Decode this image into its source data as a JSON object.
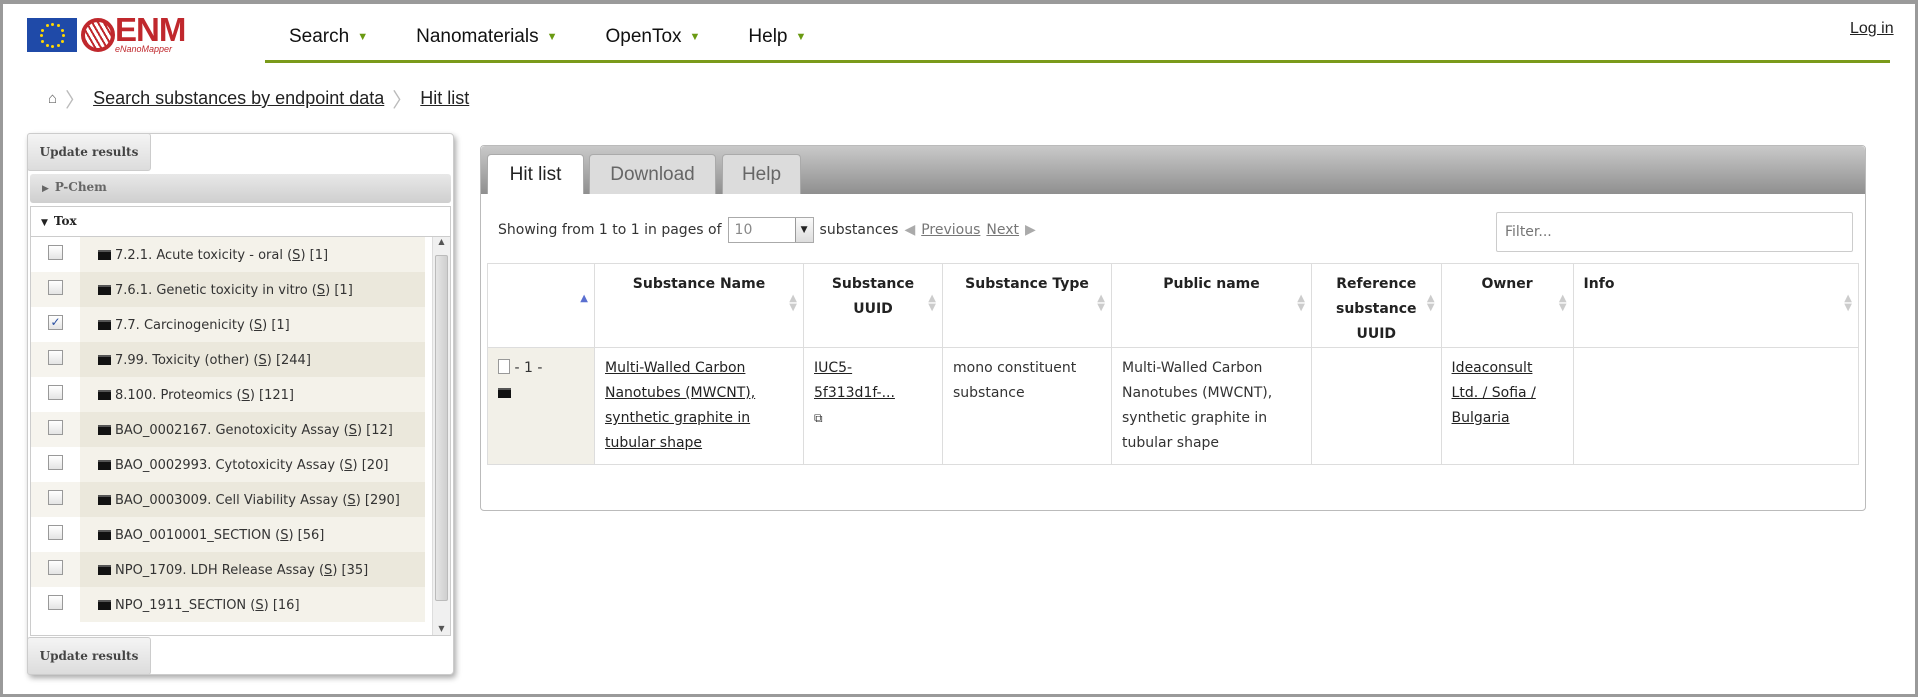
{
  "brand": {
    "name": "ENM",
    "subtitle": "eNanoMapper",
    "colors": {
      "accent": "#7a9a1a",
      "logo_red": "#c0282d",
      "eu_blue": "#1f4aa8"
    }
  },
  "nav": {
    "items": [
      {
        "label": "Search"
      },
      {
        "label": "Nanomaterials"
      },
      {
        "label": "OpenTox"
      },
      {
        "label": "Help"
      }
    ],
    "login": "Log in"
  },
  "breadcrumb": {
    "home_icon": "home-icon",
    "items": [
      "Search substances by endpoint data",
      "Hit list"
    ]
  },
  "sidebar": {
    "update_label": "Update results",
    "groups": [
      {
        "label": "P-Chem",
        "expanded": false
      },
      {
        "label": "Tox",
        "expanded": true
      }
    ],
    "items": [
      {
        "pre": "7.2.1. Acute toxicity - oral (",
        "s": "S",
        "post": ") [1]",
        "checked": false
      },
      {
        "pre": "7.6.1. Genetic toxicity in vitro (",
        "s": "S",
        "post": ") [1]",
        "checked": false
      },
      {
        "pre": "7.7. Carcinogenicity (",
        "s": "S",
        "post": ") [1]",
        "checked": true
      },
      {
        "pre": "7.99. Toxicity (other) (",
        "s": "S",
        "post": ") [244]",
        "checked": false
      },
      {
        "pre": "8.100. Proteomics (",
        "s": "S",
        "post": ") [121]",
        "checked": false
      },
      {
        "pre": "BAO_0002167. Genotoxicity Assay (",
        "s": "S",
        "post": ") [12]",
        "checked": false
      },
      {
        "pre": "BAO_0002993. Cytotoxicity Assay (",
        "s": "S",
        "post": ") [20]",
        "checked": false
      },
      {
        "pre": "BAO_0003009. Cell Viability Assay (",
        "s": "S",
        "post": ") [290]",
        "checked": false
      },
      {
        "pre": "BAO_0010001_SECTION (",
        "s": "S",
        "post": ") [56]",
        "checked": false
      },
      {
        "pre": "NPO_1709. LDH Release Assay (",
        "s": "S",
        "post": ") [35]",
        "checked": false
      },
      {
        "pre": "NPO_1911_SECTION (",
        "s": "S",
        "post": ") [16]",
        "checked": false
      }
    ]
  },
  "main": {
    "tabs": [
      "Hit list",
      "Download",
      "Help"
    ],
    "showing": "Showing from 1 to 1 in pages of",
    "page_size": "10",
    "substances": "substances",
    "previous": "Previous",
    "next": "Next",
    "filter_placeholder": "Filter...",
    "columns": [
      "",
      "Substance Name",
      "Substance UUID",
      "Substance Type",
      "Public name",
      "Reference substance UUID",
      "Owner",
      "Info"
    ],
    "rows": [
      {
        "index": "- 1 -",
        "name": "Multi-Walled Carbon Nanotubes (MWCNT), synthetic graphite in tubular shape",
        "uuid": "IUC5-5f313d1f-...",
        "type": "mono constituent substance",
        "public_name": "Multi-Walled Carbon Nanotubes (MWCNT), synthetic graphite in tubular shape",
        "reference_uuid": "",
        "owner": "Ideaconsult Ltd. / Sofia / Bulgaria",
        "info": ""
      }
    ]
  }
}
